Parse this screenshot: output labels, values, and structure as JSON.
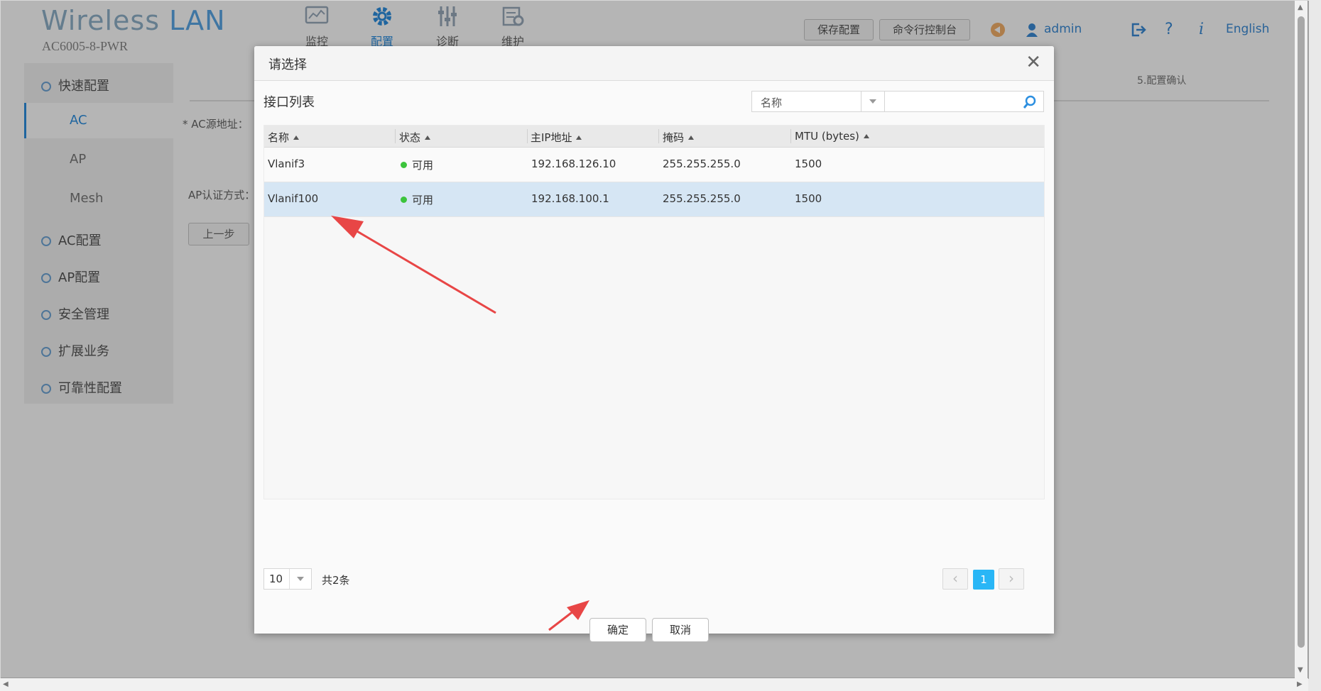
{
  "app": {
    "title_part1": "Wireless",
    "title_part2": "LAN",
    "model": "AC6005-8-PWR",
    "nav": [
      {
        "label": "监控",
        "icon": "monitor-icon"
      },
      {
        "label": "配置",
        "icon": "gear-icon"
      },
      {
        "label": "诊断",
        "icon": "sliders-icon"
      },
      {
        "label": "维护",
        "icon": "maintenance-icon"
      }
    ],
    "save_config": "保存配置",
    "cli_console": "命令行控制台",
    "user": "admin",
    "language": "English"
  },
  "sidebar": {
    "quick_config": "快速配置",
    "sub_ac": "AC",
    "sub_ap": "AP",
    "sub_mesh": "Mesh",
    "ac_config": "AC配置",
    "ap_config": "AP配置",
    "security": "安全管理",
    "extended": "扩展业务",
    "reliability": "可靠性配置"
  },
  "content": {
    "ac_source_label": "* AC源地址：",
    "ap_auth_label": "AP认证方式：",
    "prev_step": "上一步",
    "step5": "5.配置确认"
  },
  "dialog": {
    "title": "请选择",
    "section": "接口列表",
    "search_field": "名称",
    "search_placeholder": "",
    "columns": [
      "名称",
      "状态",
      "主IP地址",
      "掩码",
      "MTU (bytes)"
    ],
    "rows": [
      {
        "name": "Vlanif3",
        "status": "可用",
        "ip": "192.168.126.10",
        "mask": "255.255.255.0",
        "mtu": "1500"
      },
      {
        "name": "Vlanif100",
        "status": "可用",
        "ip": "192.168.100.1",
        "mask": "255.255.255.0",
        "mtu": "1500"
      }
    ],
    "selected_row": 1,
    "page_size": "10",
    "total": "共2条",
    "current_page": "1",
    "ok": "确定",
    "cancel": "取消"
  },
  "colors": {
    "accent": "#29b6f6",
    "selected_row": "#d6e6f4",
    "status_ok": "#3cc43c",
    "annotation": "#e84646"
  }
}
